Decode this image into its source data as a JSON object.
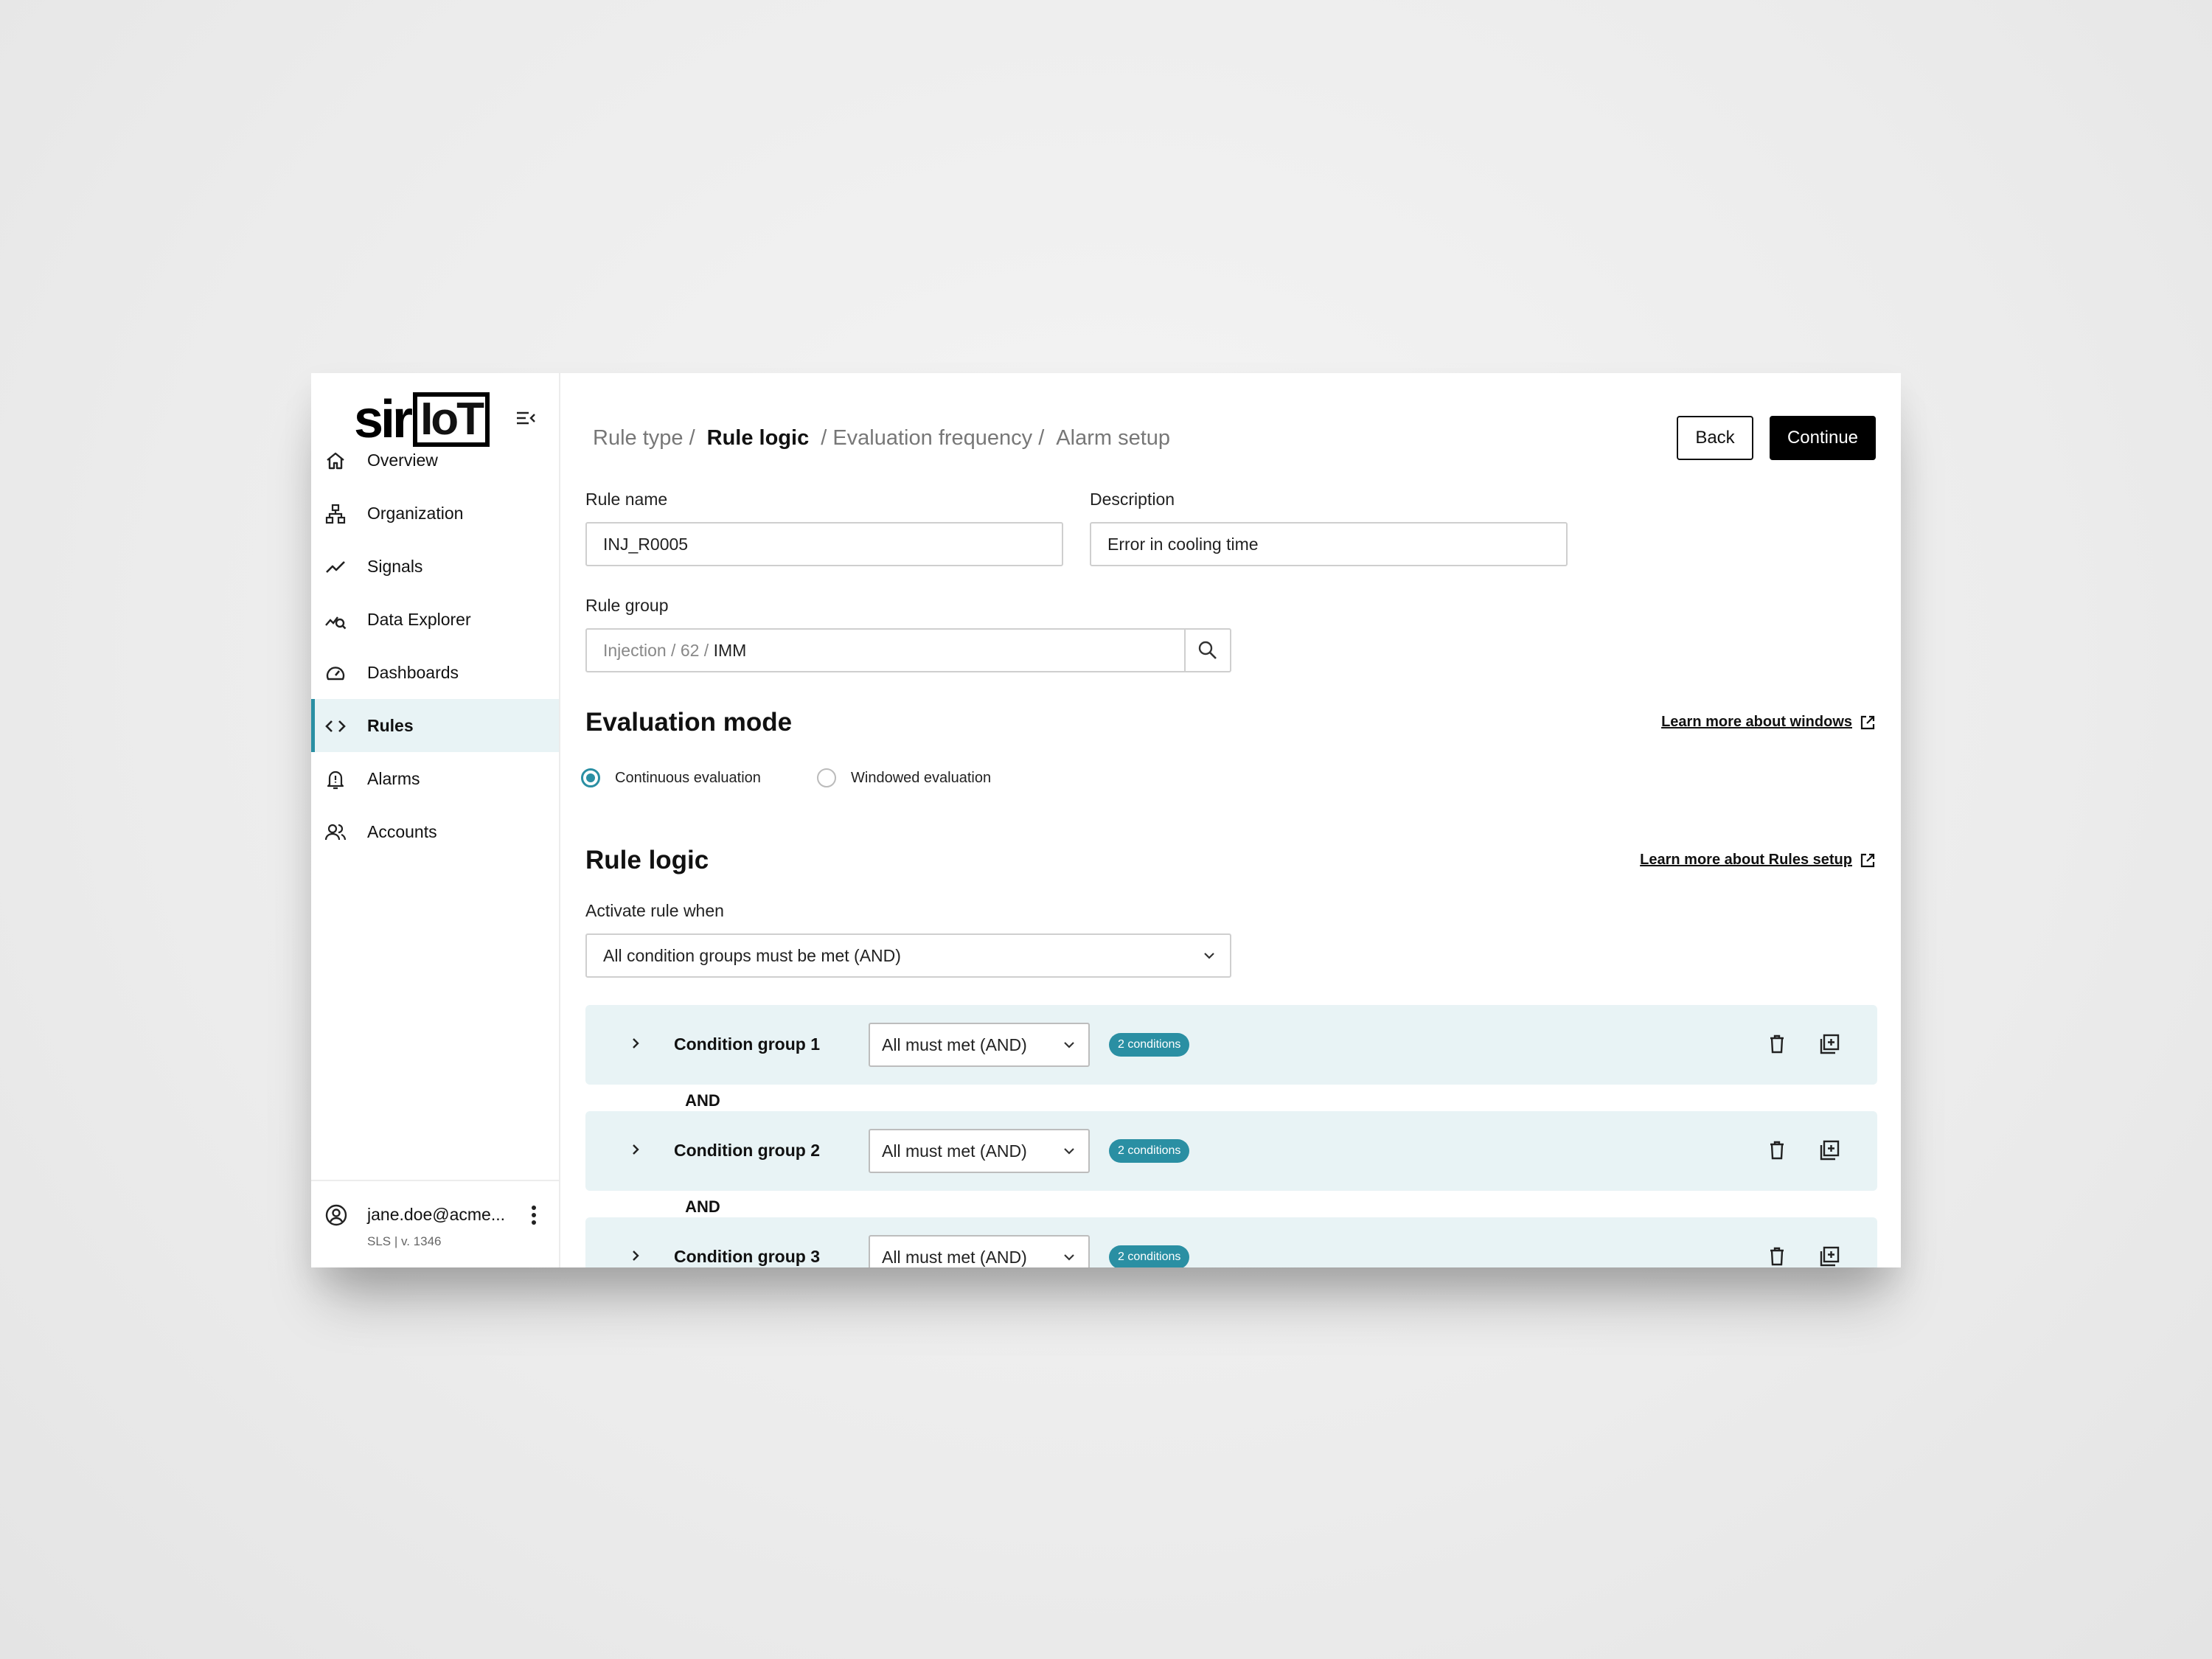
{
  "sidebar": {
    "logo": {
      "left": "sir",
      "right": "IoT"
    },
    "items": [
      {
        "label": "Overview",
        "icon": "home-icon"
      },
      {
        "label": "Organization",
        "icon": "org-chart-icon"
      },
      {
        "label": "Signals",
        "icon": "trend-line-icon"
      },
      {
        "label": "Data Explorer",
        "icon": "chart-search-icon"
      },
      {
        "label": "Dashboards",
        "icon": "gauge-icon"
      },
      {
        "label": "Rules",
        "icon": "code-brackets-icon",
        "active": true
      },
      {
        "label": "Alarms",
        "icon": "bell-alert-icon"
      },
      {
        "label": "Accounts",
        "icon": "users-icon"
      }
    ],
    "user": {
      "email": "jane.doe@acme...",
      "version": "SLS | v. 1346"
    }
  },
  "breadcrumb": [
    {
      "label": "Rule type /"
    },
    {
      "label": "Rule logic"
    },
    {
      "label": "/ Evaluation frequency /"
    },
    {
      "label": "Alarm setup"
    }
  ],
  "actions": {
    "back": "Back",
    "continue": "Continue"
  },
  "form": {
    "rule_name_label": "Rule name",
    "rule_name_value": "INJ_R0005",
    "description_label": "Description",
    "description_value": "Error in cooling time",
    "rule_group_label": "Rule group",
    "rule_group_path": "Injection / 62 / ",
    "rule_group_value": "IMM"
  },
  "evaluation": {
    "title": "Evaluation mode",
    "link": "Learn more about windows",
    "options": [
      "Continuous evaluation",
      "Windowed evaluation"
    ],
    "selected": "Continuous evaluation"
  },
  "rule_logic": {
    "title": "Rule logic",
    "link": "Learn more about Rules setup",
    "activate_label": "Activate rule when",
    "activate_value": "All condition groups must be met (AND)",
    "groups": [
      {
        "name": "Condition group 1",
        "mode": "All must met (AND)",
        "badge": "2 conditions"
      },
      {
        "name": "Condition group 2",
        "mode": "All must met (AND)",
        "badge": "2 conditions"
      },
      {
        "name": "Condition group 3",
        "mode": "All must met (AND)",
        "badge": "2 conditions"
      }
    ],
    "connector": "AND"
  },
  "colors": {
    "accent": "#2a8fa3",
    "accent_bg": "#e8f3f5"
  }
}
